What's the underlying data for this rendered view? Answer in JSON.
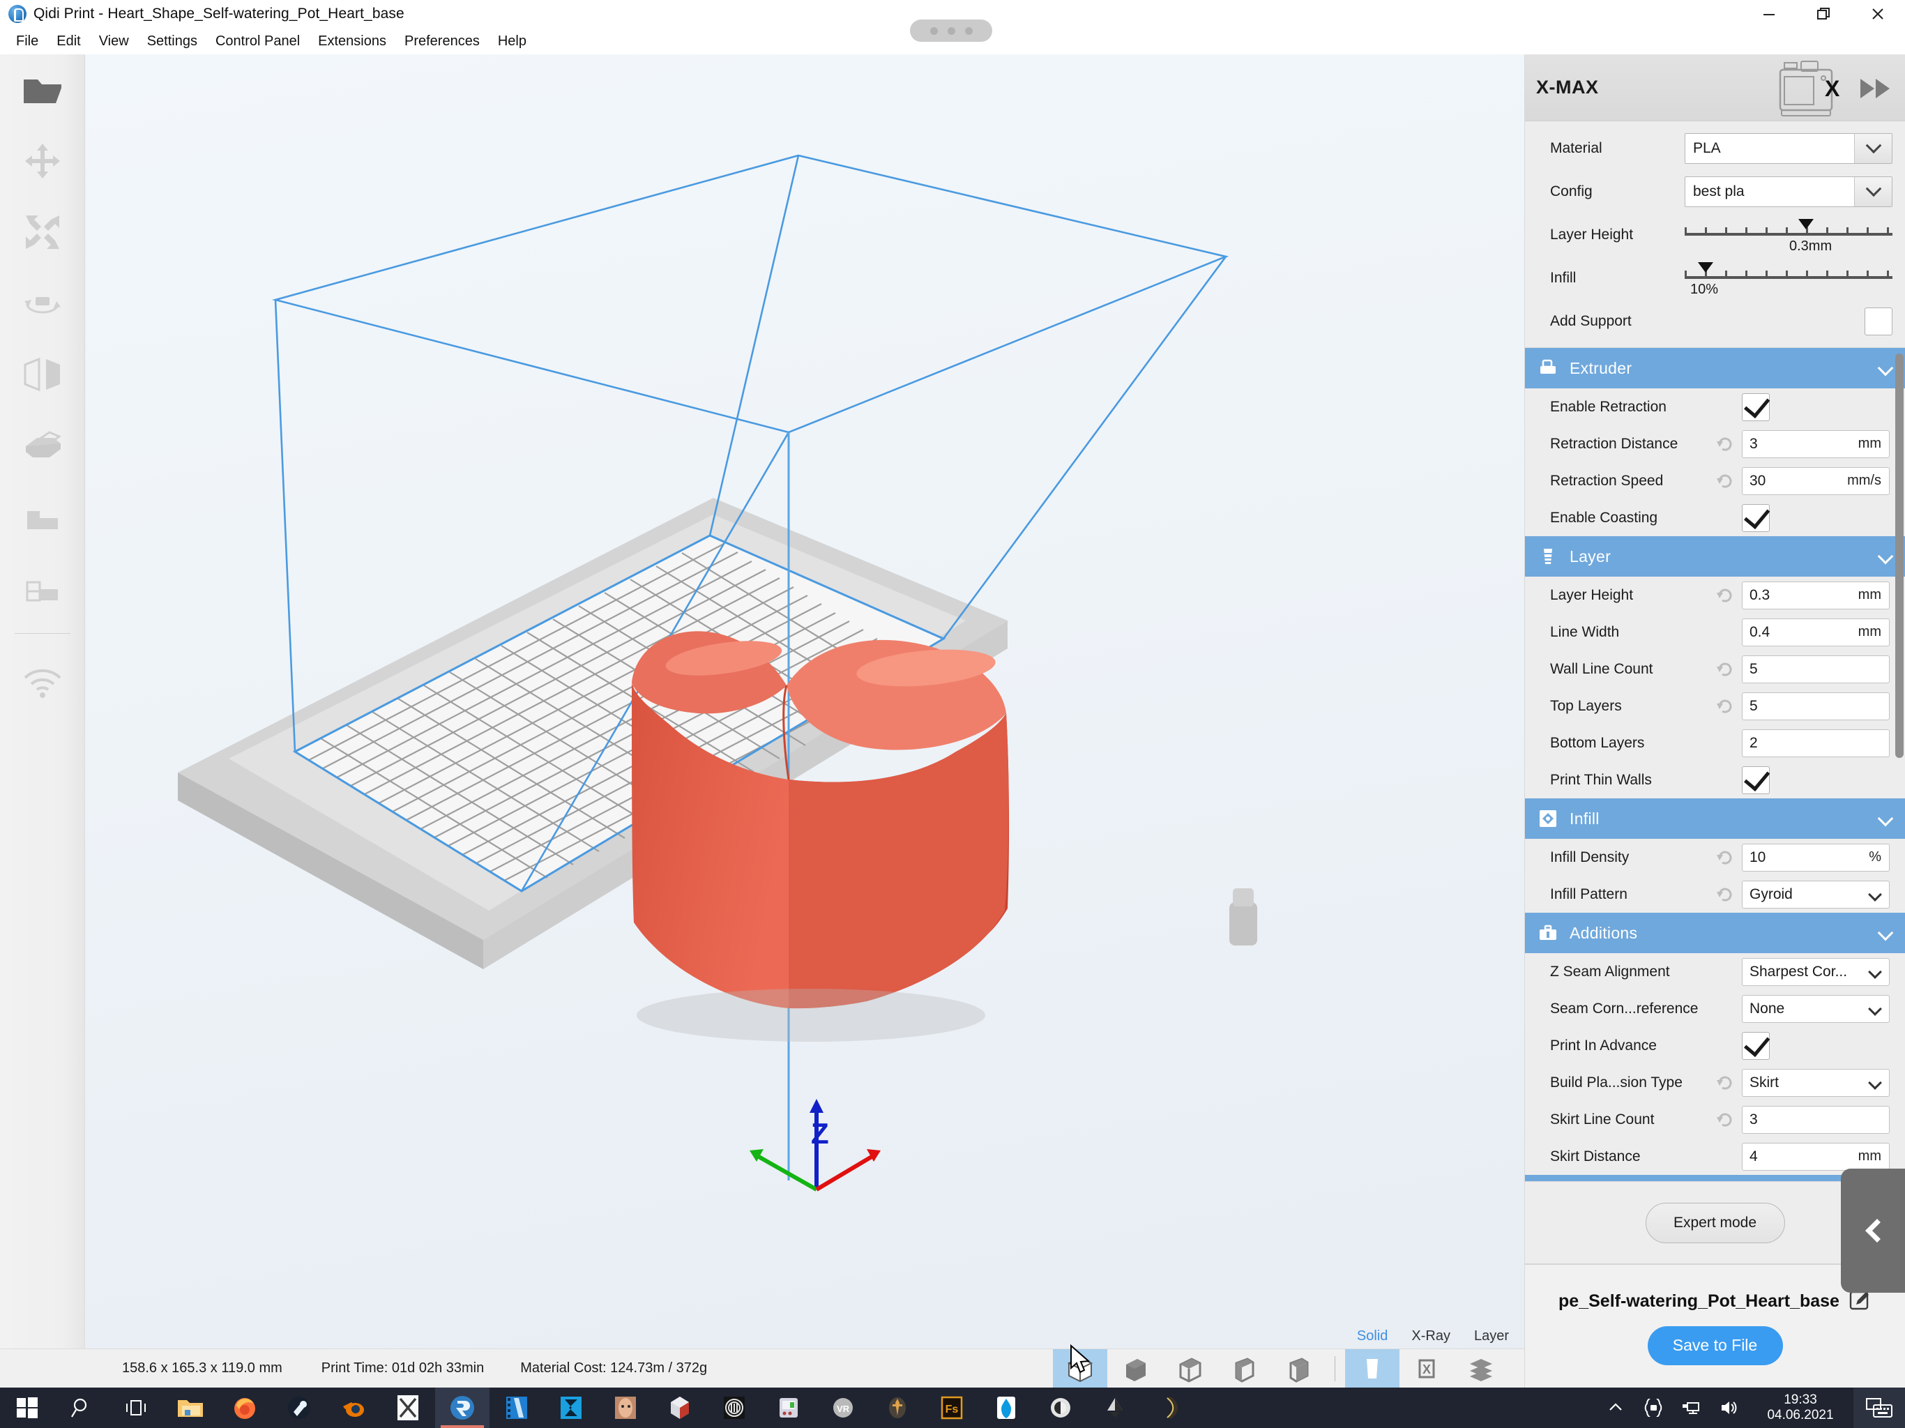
{
  "window": {
    "title": "Qidi Print - Heart_Shape_Self-watering_Pot_Heart_base",
    "app_icon": "qidi-logo-icon",
    "controls": {
      "minimize": "minimize-icon",
      "maximize": "restore-icon",
      "close": "close-icon"
    }
  },
  "menubar": {
    "items": [
      "File",
      "Edit",
      "View",
      "Settings",
      "Control Panel",
      "Extensions",
      "Preferences",
      "Help"
    ]
  },
  "left_toolbar": {
    "items": [
      {
        "name": "open-file-icon",
        "label": "Open File"
      },
      {
        "name": "move-icon",
        "label": "Move"
      },
      {
        "name": "scale-icon",
        "label": "Scale"
      },
      {
        "name": "rotate-icon",
        "label": "Rotate"
      },
      {
        "name": "mirror-icon",
        "label": "Mirror"
      },
      {
        "name": "support-blocker-icon",
        "label": "Support"
      },
      {
        "name": "arrange-icon",
        "label": "Arrange"
      },
      {
        "name": "arrange-all-icon",
        "label": "Arrange All"
      },
      {
        "name": "wifi-icon",
        "label": "Wi-Fi"
      }
    ]
  },
  "viewport": {
    "view_modes": [
      {
        "label": "Solid",
        "active": true
      },
      {
        "label": "X-Ray",
        "active": false
      },
      {
        "label": "Layer",
        "active": false
      }
    ],
    "axis_labels": {
      "z": "Z"
    },
    "model_color": "#e8604c",
    "build_volume_color": "#3a8fdd"
  },
  "statusbar": {
    "dimensions": "158.6 x 165.3 x 119.0 mm",
    "print_time": "Print Time: 01d 02h 33min",
    "material_cost": "Material Cost: 124.73m / 372g",
    "view_icons": [
      {
        "name": "view-perspective-icon",
        "selected": true
      },
      {
        "name": "view-front-icon",
        "selected": false
      },
      {
        "name": "view-top-icon",
        "selected": false
      },
      {
        "name": "view-left-icon",
        "selected": false
      },
      {
        "name": "view-right-icon",
        "selected": false
      },
      {
        "name": "printer-view-icon",
        "selected": true
      },
      {
        "name": "clear-platform-icon",
        "selected": false
      },
      {
        "name": "layers-icon",
        "selected": false
      }
    ]
  },
  "right_panel": {
    "printer_name": "X-MAX",
    "printer_thumb_icon": "printer-x-max-icon",
    "forward_icon": "fast-forward-icon",
    "basic": [
      {
        "label": "Material",
        "type": "combo",
        "value": "PLA",
        "name": "material-select"
      },
      {
        "label": "Config",
        "type": "combo",
        "value": "best pla",
        "name": "config-select"
      },
      {
        "label": "Layer Height",
        "type": "slider",
        "value": "0.3mm",
        "pos_pct": 52,
        "name": "layer-height-slider"
      },
      {
        "label": "Infill",
        "type": "slider",
        "value": "10%",
        "pos_pct": 10,
        "name": "infill-slider"
      },
      {
        "label": "Add Support",
        "type": "checkbox",
        "checked": false,
        "name": "add-support-checkbox"
      }
    ],
    "sections": [
      {
        "title": "Extruder",
        "icon": "extruder-icon",
        "rows": [
          {
            "label": "Enable Retraction",
            "type": "checkbox",
            "checked": true,
            "reset": false,
            "name": "enable-retraction-checkbox"
          },
          {
            "label": "Retraction Distance",
            "type": "text",
            "value": "3",
            "unit": "mm",
            "reset": true,
            "name": "retraction-distance-field"
          },
          {
            "label": "Retraction Speed",
            "type": "text",
            "value": "30",
            "unit": "mm/s",
            "reset": true,
            "name": "retraction-speed-field"
          },
          {
            "label": "Enable Coasting",
            "type": "checkbox",
            "checked": true,
            "reset": false,
            "name": "enable-coasting-checkbox"
          }
        ]
      },
      {
        "title": "Layer",
        "icon": "layer-stack-icon",
        "rows": [
          {
            "label": "Layer Height",
            "type": "text",
            "value": "0.3",
            "unit": "mm",
            "reset": true,
            "name": "layer-height-field"
          },
          {
            "label": "Line Width",
            "type": "text",
            "value": "0.4",
            "unit": "mm",
            "reset": false,
            "name": "line-width-field"
          },
          {
            "label": "Wall Line Count",
            "type": "text",
            "value": "5",
            "unit": "",
            "reset": true,
            "name": "wall-line-count-field"
          },
          {
            "label": "Top Layers",
            "type": "text",
            "value": "5",
            "unit": "",
            "reset": true,
            "name": "top-layers-field"
          },
          {
            "label": "Bottom Layers",
            "type": "text",
            "value": "2",
            "unit": "",
            "reset": false,
            "name": "bottom-layers-field"
          },
          {
            "label": "Print Thin Walls",
            "type": "checkbox",
            "checked": true,
            "reset": false,
            "name": "print-thin-walls-checkbox"
          }
        ]
      },
      {
        "title": "Infill",
        "icon": "infill-pattern-icon",
        "rows": [
          {
            "label": "Infill Density",
            "type": "text",
            "value": "10",
            "unit": "%",
            "reset": true,
            "name": "infill-density-field"
          },
          {
            "label": "Infill Pattern",
            "type": "combo",
            "value": "Gyroid",
            "unit": "",
            "reset": true,
            "name": "infill-pattern-select"
          }
        ]
      },
      {
        "title": "Additions",
        "icon": "toolbox-icon",
        "rows": [
          {
            "label": "Z Seam Alignment",
            "type": "combo",
            "value": "Sharpest Cor...",
            "unit": "",
            "reset": false,
            "name": "z-seam-alignment-select"
          },
          {
            "label": "Seam Corn...reference",
            "type": "combo",
            "value": "None",
            "unit": "",
            "reset": false,
            "name": "seam-corner-preference-select"
          },
          {
            "label": "Print In Advance",
            "type": "checkbox",
            "checked": true,
            "reset": false,
            "name": "print-in-advance-checkbox"
          },
          {
            "label": "Build Pla...sion Type",
            "type": "combo",
            "value": "Skirt",
            "unit": "",
            "reset": true,
            "name": "build-plate-adhesion-type-select"
          },
          {
            "label": "Skirt Line Count",
            "type": "text",
            "value": "3",
            "unit": "",
            "reset": true,
            "name": "skirt-line-count-field"
          },
          {
            "label": "Skirt Distance",
            "type": "text",
            "value": "4",
            "unit": "mm",
            "reset": false,
            "name": "skirt-distance-field"
          }
        ]
      }
    ],
    "expert_button": "Expert mode",
    "output_filename": "pe_Self-watering_Pot_Heart_base",
    "edit_filename_icon": "edit-pencil-icon",
    "save_button": "Save to File",
    "collapse_icon": "chevron-left-icon",
    "accent_color": "#6fa8dc",
    "save_color": "#3a9cf0"
  },
  "taskbar": {
    "items": [
      {
        "name": "start-button-icon"
      },
      {
        "name": "search-icon"
      },
      {
        "name": "task-view-icon"
      },
      {
        "name": "file-explorer-icon"
      },
      {
        "name": "firefox-icon"
      },
      {
        "name": "steam-icon"
      },
      {
        "name": "blender-icon"
      },
      {
        "name": "x-app-icon"
      },
      {
        "name": "qidi-print-icon",
        "active": true
      },
      {
        "name": "video-editor-icon"
      },
      {
        "name": "vegas-pro-icon"
      },
      {
        "name": "photo-app-icon"
      },
      {
        "name": "shape-app-icon"
      },
      {
        "name": "coin-app-icon"
      },
      {
        "name": "toolbox-app-icon"
      },
      {
        "name": "vr-app-icon"
      },
      {
        "name": "sword-app-icon"
      },
      {
        "name": "fs-app-icon"
      },
      {
        "name": "diamond-app-icon"
      },
      {
        "name": "gear-app-icon"
      },
      {
        "name": "inkscape-icon"
      },
      {
        "name": "curve-app-icon"
      }
    ],
    "tray": [
      {
        "name": "show-hidden-icons-chevron"
      },
      {
        "name": "onedrive-icon"
      },
      {
        "name": "network-icon"
      },
      {
        "name": "volume-icon"
      }
    ],
    "clock": {
      "time": "19:33",
      "date": "04.06.2021"
    },
    "keyboard_icon": "touch-keyboard-icon"
  }
}
